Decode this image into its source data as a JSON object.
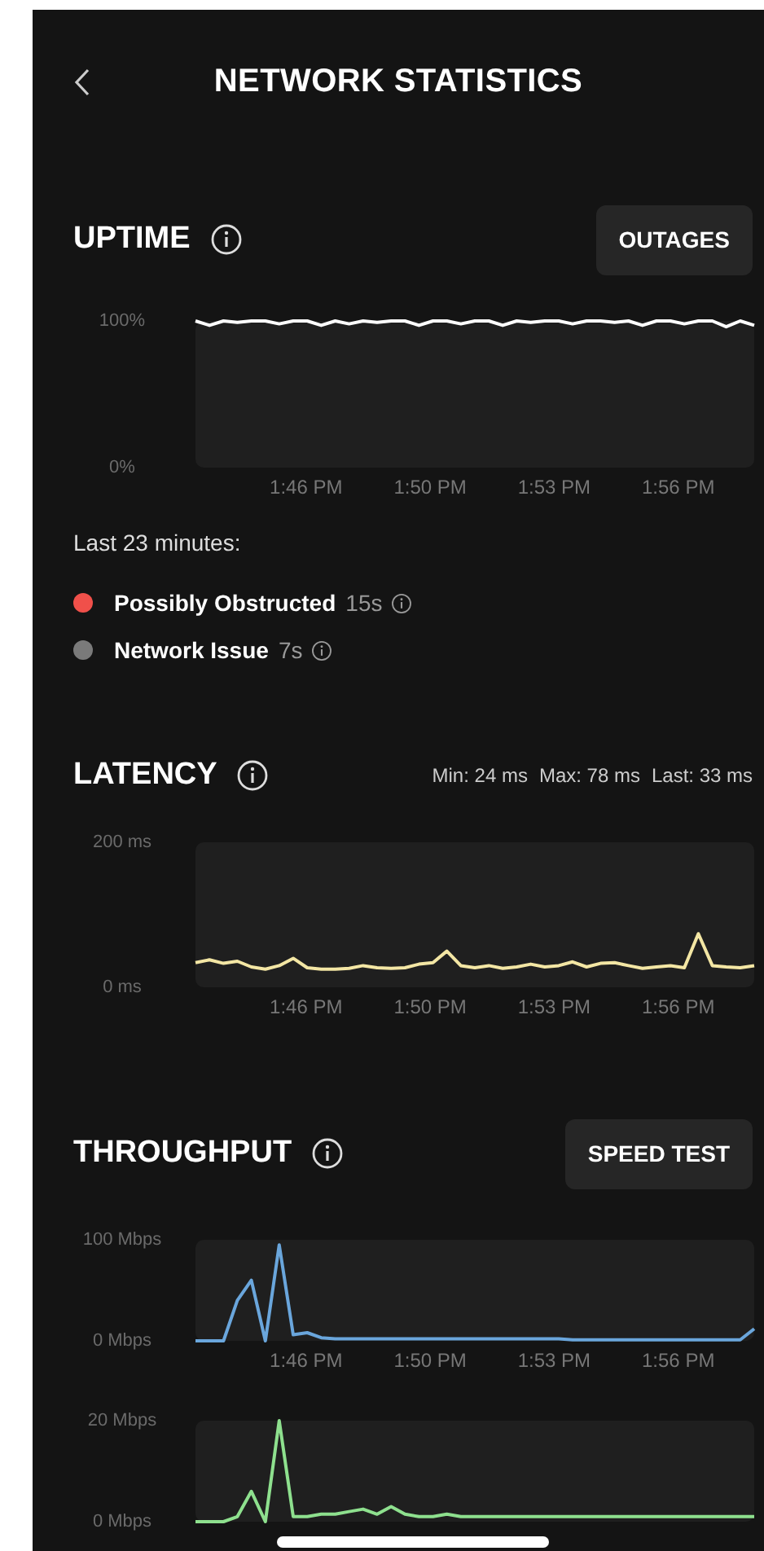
{
  "header": {
    "title": "NETWORK STATISTICS"
  },
  "uptime": {
    "title": "UPTIME",
    "button": "OUTAGES",
    "time_labels": [
      "1:46 PM",
      "1:50 PM",
      "1:53 PM",
      "1:56 PM"
    ],
    "chart_data": {
      "type": "line",
      "ylim": [
        0,
        100
      ],
      "yticks": [
        {
          "value": 100,
          "label": "100%"
        },
        {
          "value": 0,
          "label": "0%"
        }
      ],
      "series": [
        {
          "color": "#ffffff",
          "values": [
            100,
            97,
            100,
            99,
            100,
            100,
            98,
            100,
            100,
            97,
            100,
            98,
            100,
            99,
            100,
            100,
            97,
            100,
            100,
            98,
            100,
            100,
            97,
            100,
            99,
            100,
            100,
            98,
            100,
            100,
            99,
            100,
            97,
            100,
            100,
            98,
            100,
            100,
            96,
            100,
            97
          ]
        }
      ]
    },
    "caption": "Last 23 minutes:",
    "legend": [
      {
        "label": "Possibly Obstructed",
        "duration": "15s",
        "color": "#f0504a"
      },
      {
        "label": "Network Issue",
        "duration": "7s",
        "color": "#7a7a7a"
      }
    ]
  },
  "latency": {
    "title": "LATENCY",
    "stats": [
      "Min: 24 ms",
      "Max: 78 ms",
      "Last: 33 ms"
    ],
    "time_labels": [
      "1:46 PM",
      "1:50 PM",
      "1:53 PM",
      "1:56 PM"
    ],
    "chart_data": {
      "type": "line",
      "ylim": [
        0,
        200
      ],
      "yticks": [
        {
          "value": 200,
          "label": "200 ms"
        },
        {
          "value": 0,
          "label": "0 ms"
        }
      ],
      "series": [
        {
          "color": "#f3e6a4",
          "values": [
            34,
            38,
            33,
            36,
            28,
            25,
            30,
            40,
            27,
            25,
            25,
            26,
            30,
            27,
            26,
            27,
            32,
            34,
            50,
            30,
            27,
            30,
            26,
            28,
            32,
            28,
            30,
            35,
            28,
            33,
            34,
            30,
            26,
            28,
            30,
            27,
            74,
            30,
            28,
            27,
            30
          ]
        }
      ]
    }
  },
  "throughput": {
    "title": "THROUGHPUT",
    "button": "SPEED TEST",
    "charts": [
      {
        "time_labels": [
          "1:46 PM",
          "1:50 PM",
          "1:53 PM",
          "1:56 PM"
        ],
        "chart_data": {
          "type": "line",
          "ylim": [
            0,
            100
          ],
          "yticks": [
            {
              "value": 100,
              "label": "100 Mbps"
            },
            {
              "value": 0,
              "label": "0 Mbps"
            }
          ],
          "series": [
            {
              "color": "#6aa6dc",
              "values": [
                0,
                0,
                0,
                40,
                60,
                0,
                95,
                6,
                8,
                3,
                2,
                2,
                2,
                2,
                2,
                2,
                2,
                2,
                2,
                2,
                2,
                2,
                2,
                2,
                2,
                2,
                2,
                1,
                1,
                1,
                1,
                1,
                1,
                1,
                1,
                1,
                1,
                1,
                1,
                1,
                12
              ]
            }
          ]
        }
      },
      {
        "chart_data": {
          "type": "line",
          "ylim": [
            0,
            20
          ],
          "yticks": [
            {
              "value": 20,
              "label": "20 Mbps"
            },
            {
              "value": 0,
              "label": "0 Mbps"
            }
          ],
          "series": [
            {
              "color": "#8ee08e",
              "values": [
                0,
                0,
                0,
                1,
                6,
                0,
                20,
                1,
                1,
                1.5,
                1.5,
                2,
                2.5,
                1.5,
                3,
                1.5,
                1,
                1,
                1.5,
                1,
                1,
                1,
                1,
                1,
                1,
                1,
                1,
                1,
                1,
                1,
                1,
                1,
                1,
                1,
                1,
                1,
                1,
                1,
                1,
                1,
                1
              ]
            }
          ]
        }
      }
    ]
  }
}
